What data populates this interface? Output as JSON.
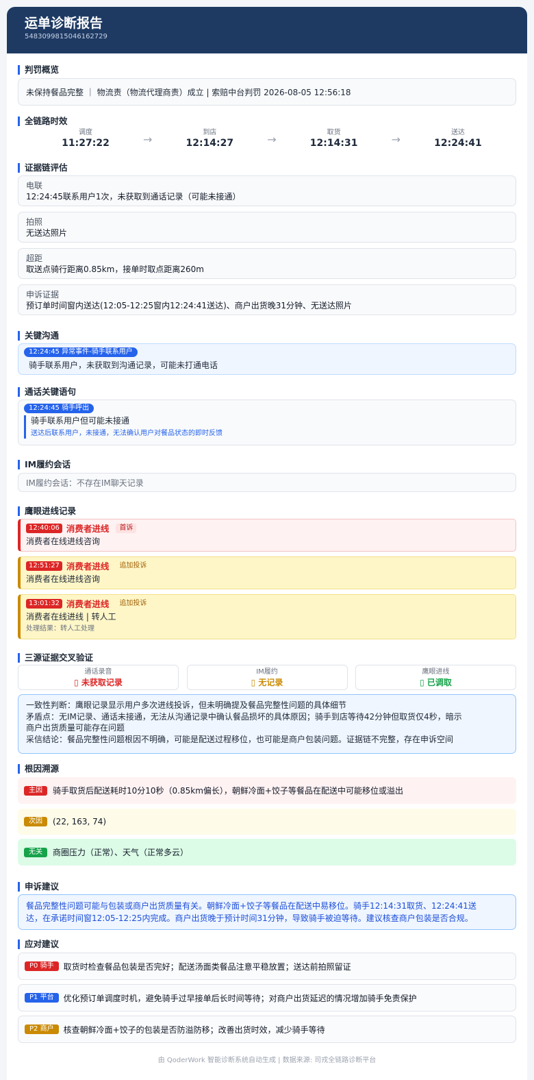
{
  "header": {
    "title": "运单诊断报告",
    "order_id": "5483099815046162729"
  },
  "sections": {
    "verdict": "判罚概览",
    "timeline": "全链路时效",
    "evidence": "证据链评估",
    "comm": "关键沟通",
    "call": "通话关键语句",
    "im": "IM履约会话",
    "hawk": "鹰眼进线记录",
    "verify": "三源证据交叉验证",
    "root": "根因溯源",
    "appeal": "申诉建议",
    "actions": "应对建议"
  },
  "verdict_text": "未保持餐品完整 ｜ 物流责（物流代理商责）成立 | 索赔中台判罚 2026-08-05 12:56:18",
  "timeline": [
    {
      "label": "调度",
      "time": "11:27:22"
    },
    {
      "label": "到店",
      "time": "12:14:27"
    },
    {
      "label": "取货",
      "time": "12:14:31"
    },
    {
      "label": "送达",
      "time": "12:24:41"
    }
  ],
  "timeline_arrow": "→",
  "evidence": [
    {
      "title": "电联",
      "body": "12:24:45联系用户1次，未获取到通话记录（可能未接通）"
    },
    {
      "title": "拍照",
      "body": "无送达照片"
    },
    {
      "title": "超距",
      "body": "取送点骑行距离0.85km，接单时取点距离260m"
    },
    {
      "title": "申诉证据",
      "body": "预订单时间窗内送达(12:05-12:25窗内12:24:41送达)、商户出货晚31分钟、无送达照片"
    }
  ],
  "comm": {
    "tag": "12:24:45  异常事件-骑手联系用户",
    "body": "骑手联系用户，未获取到沟通记录，可能未打通电话"
  },
  "call": {
    "tag": "12:24:45  骑手呼出",
    "line": "骑手联系用户但可能未接通",
    "note": "送达后联系用户，未接通，无法确认用户对餐品状态的即时反馈"
  },
  "im_text": "IM履约会话：不存在IM聊天记录",
  "hawk": [
    {
      "time": "12:40:06",
      "label": "消费者进线",
      "kind": "首诉",
      "body": "消费者在线进线咨询",
      "result": ""
    },
    {
      "time": "12:51:27",
      "label": "消费者进线",
      "kind": "追加投诉",
      "body": "消费者在线进线咨询",
      "result": ""
    },
    {
      "time": "13:01:32",
      "label": "消费者进线",
      "kind": "追加投诉",
      "body": "消费者在线进线 | 转人工",
      "result": "处理结果：转人工处理"
    }
  ],
  "verify_cards": [
    {
      "title": "通话录音",
      "value": "▯ 未获取记录",
      "color": "#dc2626"
    },
    {
      "title": "IM履约",
      "value": "▯ 无记录",
      "color": "#ca8a04"
    },
    {
      "title": "鹰眼进线",
      "value": "▯ 已调取",
      "color": "#16a34a"
    }
  ],
  "verify_text": {
    "l1": "一致性判断：鹰眼记录显示用户多次进线投诉，但未明确提及餐品完整性问题的具体细节",
    "l2": "矛盾点：无IM记录、通话未接通，无法从沟通记录中确认餐品损坏的具体原因；骑手到店等待42分钟但取货仅4秒，暗示",
    "l3": "商户出货质量可能存在问题",
    "l4": "采信结论：餐品完整性问题根因不明确，可能是配送过程移位，也可能是商户包装问题。证据链不完整，存在申诉空间"
  },
  "root": [
    {
      "tag": "主因",
      "text": "骑手取货后配送耗时10分10秒（0.85km偏长），朝鲜冷面+饺子等餐品在配送中可能移位或溢出"
    },
    {
      "tag": "次因",
      "text": "(22, 163, 74)"
    },
    {
      "tag": "无关",
      "text": "商圈压力（正常）、天气（正常多云）"
    }
  ],
  "appeal": {
    "l1": "餐品完整性问题可能与包装或商户出货质量有关。朝鲜冷面+饺子等餐品在配送中易移位。骑手12:14:31取货、12:24:41送",
    "l2": "达，在承诺时间窗12:05-12:25内完成。商户出货晚于预计时间31分钟，导致骑手被迫等待。建议核查商户包装是否合规。"
  },
  "actions": [
    {
      "tag": "P0 骑手",
      "text": "取货时检查餐品包装是否完好；配送汤面类餐品注意平稳放置；送达前拍照留证"
    },
    {
      "tag": "P1 平台",
      "text": "优化预订单调度时机，避免骑手过早接单后长时间等待；对商户出货延迟的情况增加骑手免责保护"
    },
    {
      "tag": "P2 商户",
      "text": "核查朝鲜冷面+饺子的包装是否防溢防移；改善出货时效，减少骑手等待"
    }
  ],
  "footer": "由 QoderWork 智能诊断系统自动生成 | 数据来源: 司戎全链路诊断平台"
}
